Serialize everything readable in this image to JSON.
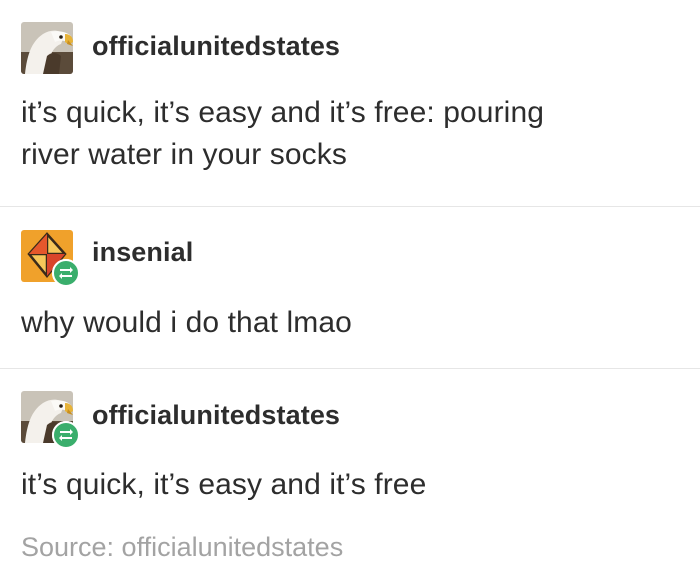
{
  "thread": [
    {
      "username": "officialunitedstates",
      "avatar_icon": "bald-eagle-avatar",
      "reblog": false,
      "lines": [
        "it’s quick, it’s easy and it’s free: pouring",
        "river water in your socks"
      ]
    },
    {
      "username": "insenial",
      "avatar_icon": "kite-avatar",
      "reblog": true,
      "lines": [
        "why would i do that lmao"
      ]
    },
    {
      "username": "officialunitedstates",
      "avatar_icon": "bald-eagle-avatar",
      "reblog": true,
      "lines": [
        "it’s quick, it’s easy and it’s free"
      ]
    }
  ],
  "footer": {
    "source_label": "Source: officialunitedstates"
  },
  "colors": {
    "reblog_green": "#3aae6c",
    "text": "#2d2d2d",
    "muted": "#a3a3a3",
    "divider": "#e6e6e6",
    "kite_orange": "#f0a12b"
  }
}
